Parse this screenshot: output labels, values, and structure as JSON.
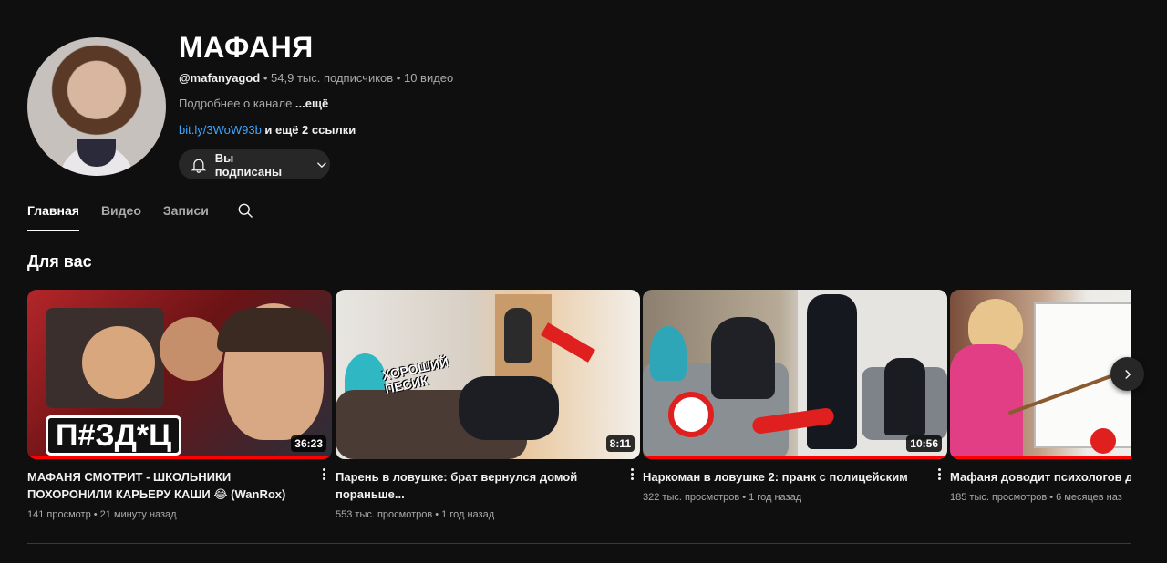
{
  "channel": {
    "name": "МАФАНЯ",
    "handle": "@mafanyagod",
    "stats": " • 54,9 тыс. подписчиков • 10 видео",
    "about": "Подробнее о канале ",
    "about_more": "...ещё",
    "link": "bit.ly/3WoW93b",
    "links_more": " и ещё 2 ссылки",
    "subscribe_label": "Вы подписаны"
  },
  "tabs": [
    "Главная",
    "Видео",
    "Записи"
  ],
  "section": {
    "title": "Для вас"
  },
  "videos": [
    {
      "title": "МАФАНЯ СМОТРИТ - ШКОЛЬНИКИ ПОХОРОНИЛИ КАРЬЕРУ КАШИ 😂 (WanRox)",
      "meta": "141 просмотр • 21 минуту назад",
      "duration": "36:23",
      "thumb_text": "П#ЗД*Ц",
      "progress": 1.0
    },
    {
      "title": "Парень в ловушке: брат вернулся домой пораньше...",
      "meta": "553 тыс. просмотров • 1 год назад",
      "duration": "8:11",
      "thumb_text": "ХОРОШИЙ ПЕСИК",
      "progress": 0.0
    },
    {
      "title": "Наркоман в ловушке 2: пранк с полицейским",
      "meta": "322 тыс. просмотров • 1 год назад",
      "duration": "10:56",
      "progress": 1.0
    },
    {
      "title": "Мафаня доводит психологов до",
      "meta": "185 тыс. просмотров • 6 месяцев наз",
      "progress": 1.0
    }
  ],
  "colors": {
    "accent": "#ff0000",
    "link": "#3ea6ff",
    "background": "#0f0f0f"
  },
  "icons": {
    "bell": "bell-icon",
    "chevron": "chevron-down-icon",
    "search": "search-icon",
    "next": "chevron-right-icon",
    "more": "more-vert-icon"
  }
}
